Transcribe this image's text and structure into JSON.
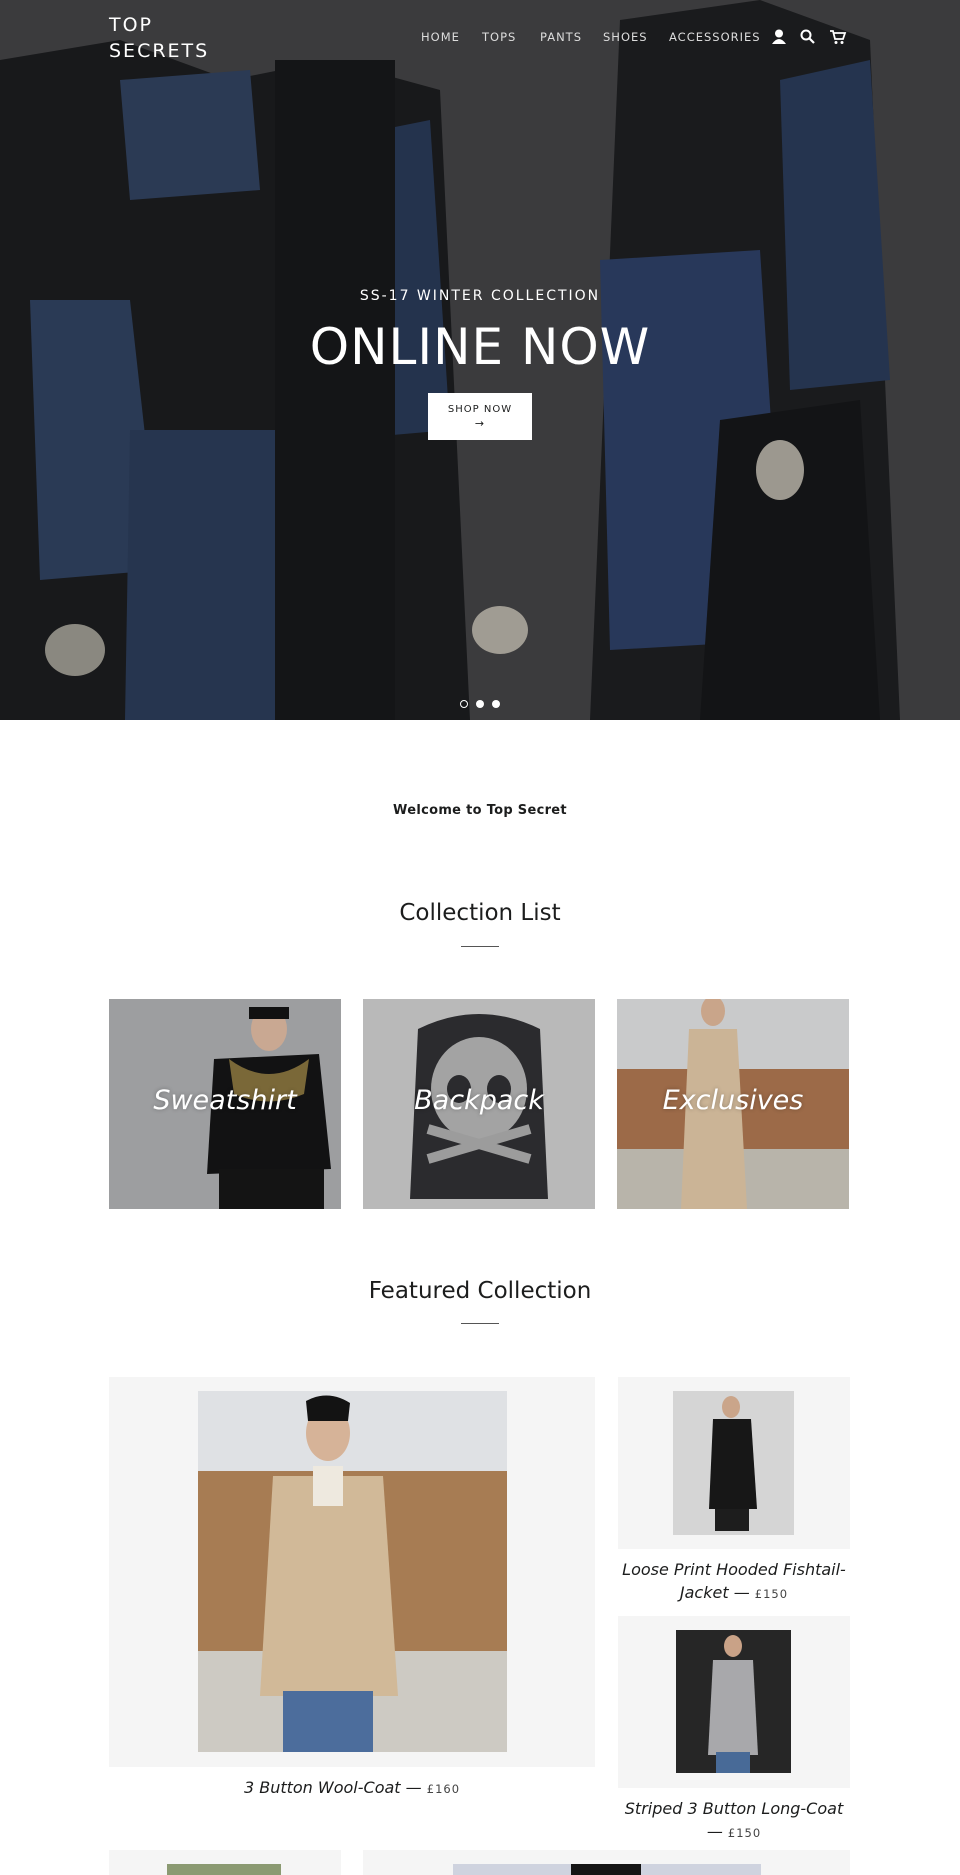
{
  "header": {
    "logo": "TOP SECRETS",
    "nav": [
      "HOME",
      "TOPS",
      "PANTS",
      "SHOES",
      "ACCESSORIES"
    ],
    "icons": [
      "account-icon",
      "search-icon",
      "cart-icon"
    ]
  },
  "hero": {
    "subtitle": "SS-17 WINTER COLLECTION",
    "title": "ONLINE NOW",
    "button_label": "SHOP NOW",
    "button_arrow": "→",
    "slides": 3,
    "active_slide": 1
  },
  "welcome": "Welcome to Top Secret",
  "collection_list": {
    "title": "Collection List",
    "items": [
      "Sweatshirt",
      "Backpack",
      "Exclusives"
    ]
  },
  "featured": {
    "title": "Featured Collection",
    "separator": "—",
    "products": [
      {
        "name": "3 Button Wool-Coat",
        "price": "£160"
      },
      {
        "name": "Loose Print Hooded Fishtail-Jacket",
        "name_line1": "Loose Print Hooded Fishtail-",
        "name_line2": "Jacket",
        "price": "£150"
      },
      {
        "name": "Striped 3 Button Long-Coat",
        "price": "£150"
      }
    ]
  },
  "colors": {
    "hero_overlay": "#3a3a3c",
    "denim": "#25344e",
    "card_bg": "#f5f5f5",
    "text": "#1c1d1d"
  }
}
